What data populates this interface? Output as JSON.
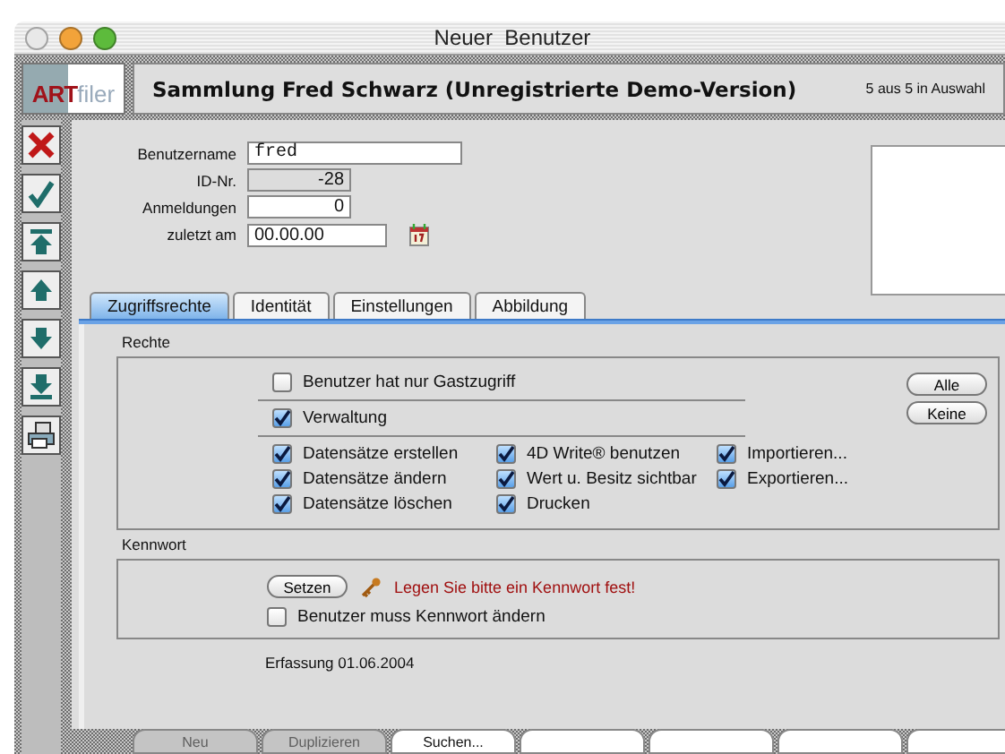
{
  "window": {
    "title": "Neuer  Benutzer"
  },
  "header": {
    "logo": {
      "brand": "ART",
      "suffix": "filer"
    },
    "title": "Sammlung Fred Schwarz (Unregistrierte Demo-Version)",
    "selection": "5 aus 5 in Auswahl"
  },
  "fields": [
    {
      "label": "Benutzername",
      "value": "fred",
      "kind": "text",
      "readonly": false
    },
    {
      "label": "ID-Nr.",
      "value": "-28",
      "kind": "number",
      "readonly": true
    },
    {
      "label": "Anmeldungen",
      "value": "0",
      "kind": "number",
      "readonly": false
    },
    {
      "label": "zuletzt am",
      "value": "00.00.00",
      "kind": "date",
      "readonly": false
    }
  ],
  "tabs": [
    {
      "label": "Zugriffsrechte",
      "selected": true
    },
    {
      "label": "Identität",
      "selected": false
    },
    {
      "label": "Einstellungen",
      "selected": false
    },
    {
      "label": "Abbildung",
      "selected": false
    }
  ],
  "rights": {
    "title": "Rechte",
    "guest": {
      "label": "Benutzer hat nur Gastzugriff",
      "checked": false
    },
    "admin": {
      "label": "Verwaltung",
      "checked": true
    },
    "columns": [
      [
        {
          "label": "Datensätze erstellen",
          "checked": true
        },
        {
          "label": "Datensätze ändern",
          "checked": true
        },
        {
          "label": "Datensätze löschen",
          "checked": true
        }
      ],
      [
        {
          "label": "4D Write® benutzen",
          "checked": true
        },
        {
          "label": "Wert u. Besitz sichtbar",
          "checked": true
        },
        {
          "label": "Drucken",
          "checked": true
        }
      ],
      [
        {
          "label": "Importieren...",
          "checked": true
        },
        {
          "label": "Exportieren...",
          "checked": true
        }
      ]
    ],
    "buttons": [
      "Alle",
      "Keine"
    ]
  },
  "password": {
    "title": "Kennwort",
    "button": "Setzen",
    "warning": "Legen Sie bitte ein Kennwort fest!",
    "must_change": {
      "label": "Benutzer muss Kennwort ändern",
      "checked": false
    }
  },
  "created": "Erfassung 01.06.2004",
  "bottom_buttons": [
    {
      "label": "Neu",
      "disabled": true
    },
    {
      "label": "Duplizieren",
      "disabled": true
    },
    {
      "label": "Suchen...",
      "disabled": false
    },
    {
      "disabled": false
    },
    {
      "disabled": false
    },
    {
      "disabled": false
    },
    {
      "disabled": false
    }
  ]
}
